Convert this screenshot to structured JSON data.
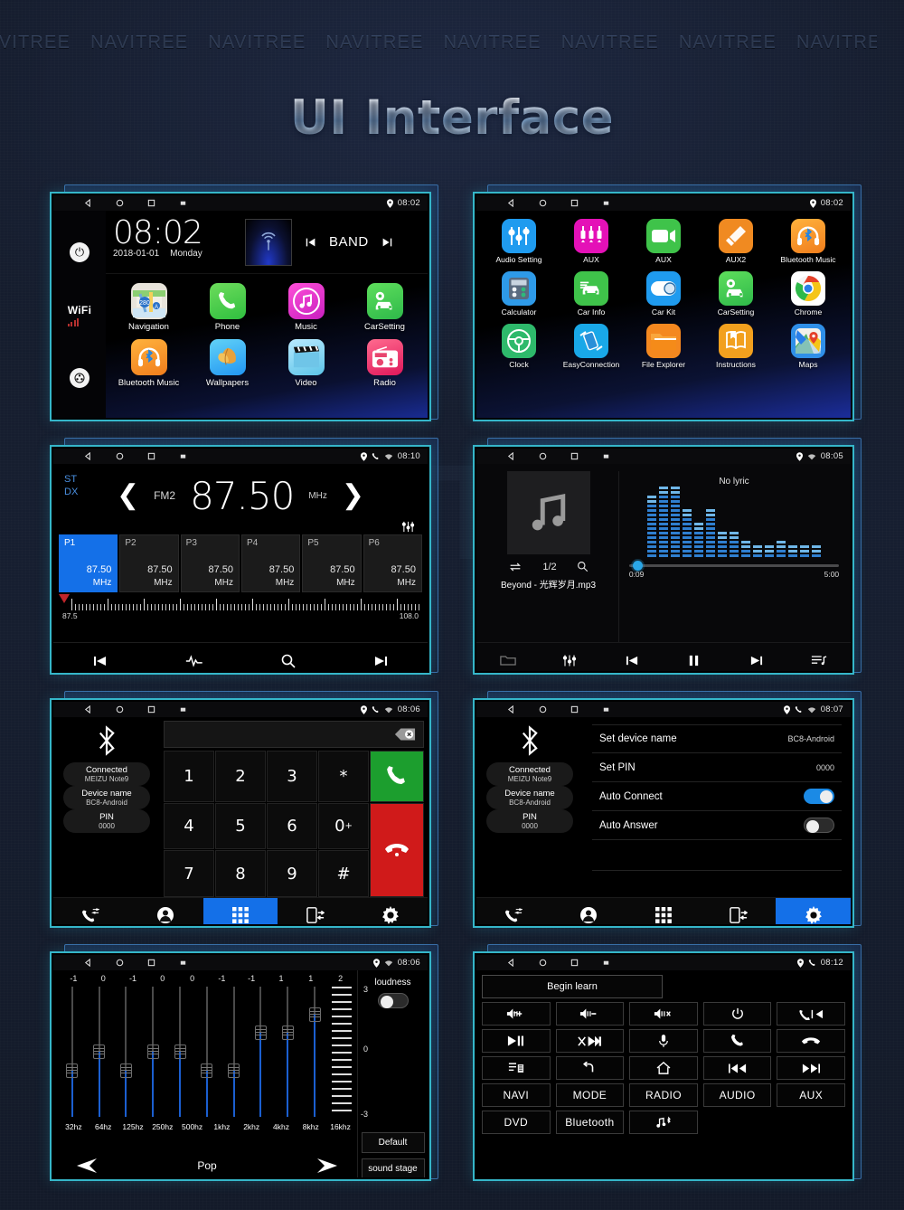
{
  "page": {
    "title": "UI Interface",
    "watermark_word": "NAVITREE",
    "watermark_repeat": 10,
    "watermark_big": "NAVITREE",
    "colors": {
      "background": "#151c2c",
      "panel_border": "#35b6c9",
      "shadow_card_border": "#3a6ea8",
      "accent_blue": "#1470e8",
      "call_green": "#1c9e2e",
      "end_red": "#d01a1a"
    }
  },
  "screens": {
    "home": {
      "statusbar": {
        "time": "08:02",
        "icons": [
          "back-icon",
          "home-icon",
          "recents-icon",
          "screenshot-icon",
          "location-pin-icon"
        ]
      },
      "sidebar": {
        "power_icon": "power-icon",
        "wifi_label": "WiFi",
        "apps_icon": "apps-grid-icon"
      },
      "clock": {
        "time": "08:02",
        "date": "2018-01-01",
        "day": "Monday"
      },
      "radio_widget": {
        "icon": "antenna-icon",
        "prev": "prev-icon",
        "band_label": "BAND",
        "next": "next-icon"
      },
      "apps": [
        {
          "label": "Navigation",
          "icon": "map-icon"
        },
        {
          "label": "Phone",
          "icon": "phone-icon"
        },
        {
          "label": "Music",
          "icon": "music-note-icon"
        },
        {
          "label": "CarSetting",
          "icon": "car-gear-icon"
        },
        {
          "label": "Bluetooth Music",
          "icon": "bluetooth-headphone-icon"
        },
        {
          "label": "Wallpapers",
          "icon": "leaf-icon"
        },
        {
          "label": "Video",
          "icon": "clapperboard-icon"
        },
        {
          "label": "Radio",
          "icon": "radio-icon"
        }
      ]
    },
    "apps_drawer": {
      "statusbar": {
        "time": "08:02"
      },
      "apps": [
        {
          "label": "Audio Setting",
          "icon": "sliders-icon",
          "color": "#1f9bef"
        },
        {
          "label": "AUX",
          "icon": "aux-jacks-icon",
          "color": "#e411b7"
        },
        {
          "label": "AUX",
          "icon": "video-camera-icon",
          "color": "#3fc34a"
        },
        {
          "label": "AUX2",
          "icon": "aux-cable-icon",
          "color": "#f08a21"
        },
        {
          "label": "Bluetooth Music",
          "icon": "bluetooth-headphone-icon",
          "color": "#f39324"
        },
        {
          "label": "Calculator",
          "icon": "calculator-icon",
          "color": "#2e9ae8"
        },
        {
          "label": "Car Info",
          "icon": "car-info-icon",
          "color": "#3fc34a"
        },
        {
          "label": "Car Kit",
          "icon": "toggle-icon",
          "color": "#1f9bef"
        },
        {
          "label": "CarSetting",
          "icon": "car-gear-icon",
          "color": "#2eb94a"
        },
        {
          "label": "Chrome",
          "icon": "chrome-icon",
          "color": "#ffffff"
        },
        {
          "label": "Clock",
          "icon": "steering-wheel-icon",
          "color": "#2eb96b"
        },
        {
          "label": "EasyConnection",
          "icon": "phone-mirror-icon",
          "color": "#19a8e8"
        },
        {
          "label": "File Explorer",
          "icon": "folder-icon",
          "color": "#f4881f"
        },
        {
          "label": "Instructions",
          "icon": "book-icon",
          "color": "#f2a01e"
        },
        {
          "label": "Maps",
          "icon": "google-maps-icon",
          "color": "#2f8fe8"
        }
      ]
    },
    "radio": {
      "statusbar": {
        "time": "08:10",
        "icons": [
          "location-pin-icon",
          "phone-icon",
          "wifi-icon"
        ]
      },
      "stereo_label": "ST",
      "distance_label": "DX",
      "prev_icon": "chevron-left-icon",
      "next_icon": "chevron-right-icon",
      "band": "FM2",
      "frequency": "87.50",
      "unit": "MHz",
      "eq_icon": "equalizer-icon",
      "presets": [
        {
          "name": "P1",
          "freq": "87.50",
          "unit": "MHz",
          "active": true
        },
        {
          "name": "P2",
          "freq": "87.50",
          "unit": "MHz",
          "active": false
        },
        {
          "name": "P3",
          "freq": "87.50",
          "unit": "MHz",
          "active": false
        },
        {
          "name": "P4",
          "freq": "87.50",
          "unit": "MHz",
          "active": false
        },
        {
          "name": "P5",
          "freq": "87.50",
          "unit": "MHz",
          "active": false
        },
        {
          "name": "P6",
          "freq": "87.50",
          "unit": "MHz",
          "active": false
        }
      ],
      "scale_min": "87.5",
      "scale_max": "108.0",
      "toolbar": [
        "prev-station-icon",
        "waveform-icon",
        "search-icon",
        "next-station-icon"
      ]
    },
    "music": {
      "statusbar": {
        "time": "08:05"
      },
      "album_icon": "music-note-icon",
      "repeat_icon": "repeat-icon",
      "track_index": "1/2",
      "search_icon": "search-icon",
      "track_title": "Beyond - 光辉岁月.mp3",
      "lyric_text": "No lyric",
      "time_current": "0:09",
      "time_total": "5:00",
      "spectrum_levels": [
        14,
        16,
        16,
        11,
        8,
        11,
        6,
        6,
        4,
        3,
        3,
        4,
        3,
        3,
        3
      ],
      "toolbar": [
        "folder-icon",
        "equalizer-icon",
        "previous-icon",
        "pause-icon",
        "next-icon",
        "playlist-icon"
      ]
    },
    "bt_dialer": {
      "statusbar": {
        "time": "08:06"
      },
      "bluetooth_icon": "bluetooth-icon",
      "info": [
        {
          "key": "Connected",
          "value": "MEIZU Note9"
        },
        {
          "key": "Device name",
          "value": "BC8-Android"
        },
        {
          "key": "PIN",
          "value": "0000"
        }
      ],
      "dial_value": "",
      "backspace_icon": "backspace-icon",
      "keys": [
        "1",
        "2",
        "3",
        "*",
        "4",
        "5",
        "6",
        "0",
        "7",
        "8",
        "9",
        "#"
      ],
      "zero_plus": "+",
      "call_icon": "call-icon",
      "end_icon": "end-call-icon",
      "tabs": [
        {
          "name": "call-history",
          "icon": "call-history-icon",
          "active": false
        },
        {
          "name": "contacts",
          "icon": "contact-icon",
          "active": false
        },
        {
          "name": "keypad",
          "icon": "keypad-icon",
          "active": true
        },
        {
          "name": "sync",
          "icon": "sync-phone-icon",
          "active": false
        },
        {
          "name": "settings",
          "icon": "gear-icon",
          "active": false
        }
      ]
    },
    "bt_settings": {
      "statusbar": {
        "time": "08:07"
      },
      "bluetooth_icon": "bluetooth-icon",
      "info": [
        {
          "key": "Connected",
          "value": "MEIZU Note9"
        },
        {
          "key": "Device name",
          "value": "BC8-Android"
        },
        {
          "key": "PIN",
          "value": "0000"
        }
      ],
      "rows": [
        {
          "label": "Set device name",
          "value": "BC8-Android",
          "type": "text"
        },
        {
          "label": "Set PIN",
          "value": "0000",
          "type": "text"
        },
        {
          "label": "Auto Connect",
          "value": "on",
          "type": "toggle"
        },
        {
          "label": "Auto Answer",
          "value": "off",
          "type": "toggle"
        }
      ],
      "tabs": [
        {
          "name": "call-history",
          "icon": "call-history-icon",
          "active": false
        },
        {
          "name": "contacts",
          "icon": "contact-icon",
          "active": false
        },
        {
          "name": "keypad",
          "icon": "keypad-icon",
          "active": false
        },
        {
          "name": "sync",
          "icon": "sync-phone-icon",
          "active": false
        },
        {
          "name": "settings",
          "icon": "gear-icon",
          "active": true
        }
      ]
    },
    "equalizer": {
      "statusbar": {
        "time": "08:06"
      },
      "bands": [
        {
          "freq": "32hz",
          "value": -1
        },
        {
          "freq": "64hz",
          "value": 0
        },
        {
          "freq": "125hz",
          "value": -1
        },
        {
          "freq": "250hz",
          "value": 0
        },
        {
          "freq": "500hz",
          "value": 0
        },
        {
          "freq": "1khz",
          "value": -1
        },
        {
          "freq": "2khz",
          "value": -1
        },
        {
          "freq": "4khz",
          "value": 1
        },
        {
          "freq": "8khz",
          "value": 1
        },
        {
          "freq": "16khz",
          "value": 2
        }
      ],
      "scale_top": "3",
      "scale_mid": "0",
      "scale_bottom": "-3",
      "preset_name": "Pop",
      "prev_icon": "prev-preset-icon",
      "next_icon": "next-preset-icon",
      "loudness_label": "loudness",
      "loudness_state": "off",
      "default_button": "Default",
      "sound_stage_button": "sound stage"
    },
    "swc_learn": {
      "statusbar": {
        "time": "08:12"
      },
      "begin_button": "Begin learn",
      "buttons": [
        {
          "label": "",
          "icon": "volume-up-icon"
        },
        {
          "label": "",
          "icon": "volume-down-icon"
        },
        {
          "label": "",
          "icon": "mute-icon"
        },
        {
          "label": "",
          "icon": "power-icon"
        },
        {
          "label": "",
          "icon": "call-prev-icon"
        },
        {
          "label": "",
          "icon": "play-pause-icon"
        },
        {
          "label": "",
          "icon": "shuffle-next-icon"
        },
        {
          "label": "",
          "icon": "microphone-icon"
        },
        {
          "label": "",
          "icon": "call-icon"
        },
        {
          "label": "",
          "icon": "end-call-icon"
        },
        {
          "label": "",
          "icon": "playlist-icon"
        },
        {
          "label": "",
          "icon": "back-arrow-icon"
        },
        {
          "label": "",
          "icon": "home-icon"
        },
        {
          "label": "",
          "icon": "previous-track-icon"
        },
        {
          "label": "",
          "icon": "next-track-icon"
        },
        {
          "label": "NAVI",
          "icon": ""
        },
        {
          "label": "MODE",
          "icon": ""
        },
        {
          "label": "RADIO",
          "icon": ""
        },
        {
          "label": "AUDIO",
          "icon": ""
        },
        {
          "label": "AUX",
          "icon": ""
        },
        {
          "label": "DVD",
          "icon": ""
        },
        {
          "label": "Bluetooth",
          "icon": ""
        },
        {
          "label": "",
          "icon": "bt-music-icon"
        }
      ]
    }
  }
}
